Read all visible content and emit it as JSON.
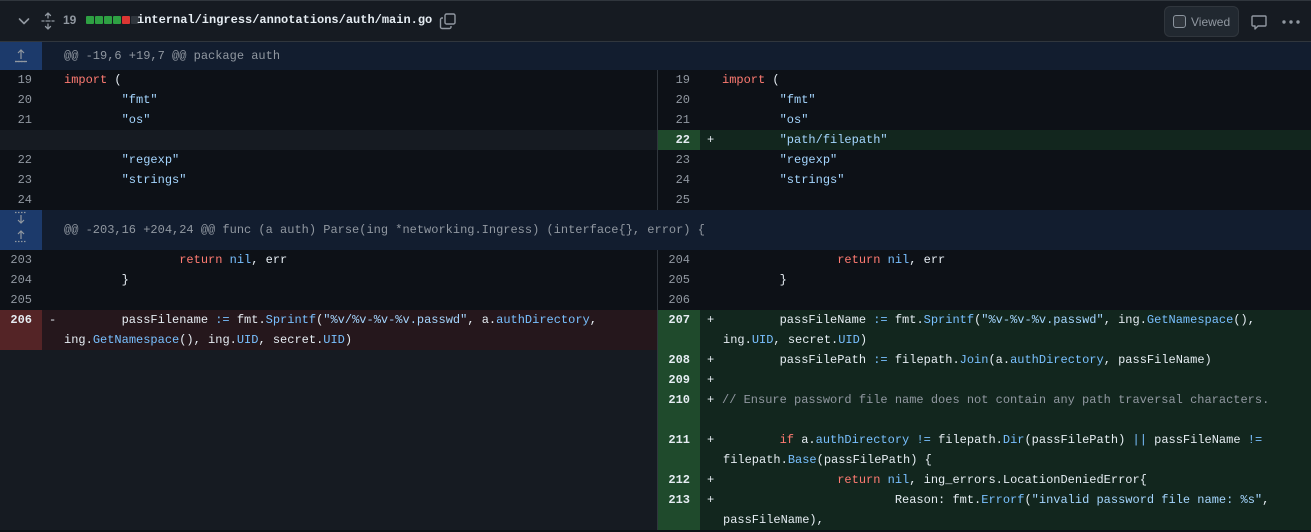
{
  "file": {
    "changes_count": "19",
    "path": "internal/ingress/annotations/auth/main.go",
    "viewed_label": "Viewed",
    "diffstat": [
      "#2ea043",
      "#2ea043",
      "#2ea043",
      "#2ea043",
      "#da3633",
      "#30363d"
    ]
  },
  "hunks": [
    {
      "header": "@@ -19,6 +19,7 @@ package auth"
    },
    {
      "header": "@@ -203,16 +204,24 @@ func (a auth) Parse(ing *networking.Ingress) (interface{}, error) {"
    }
  ],
  "lines": {
    "h1": [
      {
        "l": "19",
        "r": "19"
      },
      {
        "l": "20",
        "r": "20"
      },
      {
        "l": "21",
        "r": "21"
      },
      {
        "l": "",
        "r": "22"
      },
      {
        "l": "22",
        "r": "23"
      },
      {
        "l": "23",
        "r": "24"
      },
      {
        "l": "24",
        "r": "25"
      }
    ],
    "h2": [
      {
        "l": "203",
        "r": "204"
      },
      {
        "l": "204",
        "r": "205"
      },
      {
        "l": "205",
        "r": "206"
      },
      {
        "l": "206",
        "r": "207"
      },
      {
        "l": "",
        "r": "208"
      },
      {
        "l": "",
        "r": "209"
      },
      {
        "l": "",
        "r": "210"
      },
      {
        "l": "",
        "r": "211"
      },
      {
        "l": "",
        "r": "212"
      },
      {
        "l": "",
        "r": "213"
      }
    ]
  },
  "code": {
    "import": "import",
    "paren_open": " (",
    "fmt": "\"fmt\"",
    "os": "\"os\"",
    "filepath": "\"path/filepath\"",
    "regexp": "\"regexp\"",
    "strings": "\"strings\"",
    "return": "return",
    "nil": "nil",
    "err_tail": ", err",
    "close_brace": "}",
    "plus": "+",
    "minus": "-",
    "del_line": {
      "var": "passFilename",
      "assign": ":=",
      "pkg": "fmt.",
      "fn": "Sprintf",
      "fmtstr": "\"%v/%v-%v-%v.passwd\"",
      "mid": ", a.",
      "field": "authDirectory",
      "tail": ",",
      "ing": "ing.",
      "getns": "GetNamespace",
      "paren": "(), ing.",
      "uid": "UID",
      "secret": ", secret.",
      "uid2": "UID",
      "end": ")"
    },
    "add207": {
      "var": "passFileName",
      "assign": ":=",
      "pkg": "fmt.",
      "fn": "Sprintf",
      "fmtstr": "\"%v-%v-%v.passwd\"",
      "mid": ", ing.",
      "getns": "GetNamespace",
      "tail": "(),",
      "ing": "ing.",
      "uid": "UID",
      "secret": ", secret.",
      "uid2": "UID",
      "end": ")"
    },
    "add208": {
      "var": "passFilePath",
      "assign": ":=",
      "pkg": "filepath.",
      "fn": "Join",
      "mid": "(a.",
      "field": "authDirectory",
      "end": ", passFileName)"
    },
    "add210": "// Ensure password file name does not contain any path traversal characters.",
    "add211": {
      "if": "if",
      "a": "a.",
      "field": "authDirectory",
      "ne": "!=",
      "pkg": "filepath.",
      "fn": "Dir",
      "mid": "(passFilePath)",
      "or": "||",
      "pfn": "passFileName",
      "ne2": "!=",
      "pkg2": "filepath.",
      "fn2": "Base",
      "end": "(passFilePath) {"
    },
    "add212": {
      "ret": "return",
      "nil": "nil",
      "end": ", ing_errors.LocationDeniedError{"
    },
    "add213": {
      "key": "Reason: fmt.",
      "fn": "Errorf",
      "open": "(",
      "str": "\"invalid password file name: %s\"",
      "end": ",",
      "cont": "passFileName),"
    }
  }
}
